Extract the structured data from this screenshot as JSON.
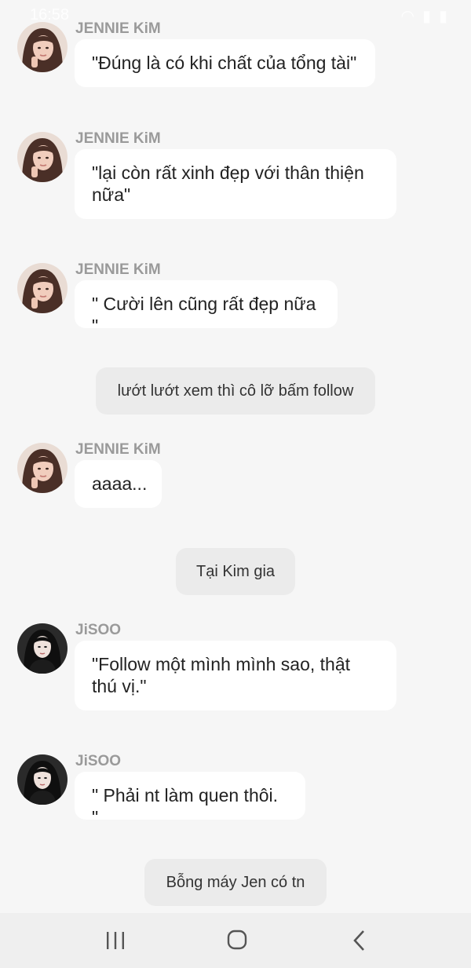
{
  "status_bar": {
    "time": "16:58"
  },
  "messages": [
    {
      "kind": "chat",
      "sender": "JENNIE KiM",
      "avatar": "jennie",
      "text": "\"Đúng là có khi chất của tổng tài\""
    },
    {
      "kind": "chat",
      "sender": "JENNIE KiM",
      "avatar": "jennie",
      "text": "\"lại còn rất xinh đẹp với thân thiện nữa\""
    },
    {
      "kind": "chat",
      "sender": "JENNIE KiM",
      "avatar": "jennie",
      "text": "\" Cười lên cũng rất đẹp nữa \""
    },
    {
      "kind": "narration",
      "text": "lướt lướt xem thì cô lỡ bấm follow"
    },
    {
      "kind": "chat",
      "sender": "JENNIE KiM",
      "avatar": "jennie",
      "text": "aaaa..."
    },
    {
      "kind": "narration",
      "text": "Tại Kim gia"
    },
    {
      "kind": "chat",
      "sender": "JiSOO",
      "avatar": "jisoo",
      "text": "\"Follow một mình mình sao, thật thú vị.\""
    },
    {
      "kind": "chat",
      "sender": "JiSOO",
      "avatar": "jisoo",
      "text": "\" Phải nt làm quen thôi. \""
    },
    {
      "kind": "narration",
      "text": "Bỗng máy Jen có tn"
    }
  ],
  "nav_bar": {
    "icons": [
      "recent-apps-icon",
      "home-icon",
      "back-icon"
    ]
  },
  "colors": {
    "background": "#f6f6f6",
    "bubble": "#ffffff",
    "narration": "#ebebeb",
    "sender": "#9a9a9a"
  }
}
